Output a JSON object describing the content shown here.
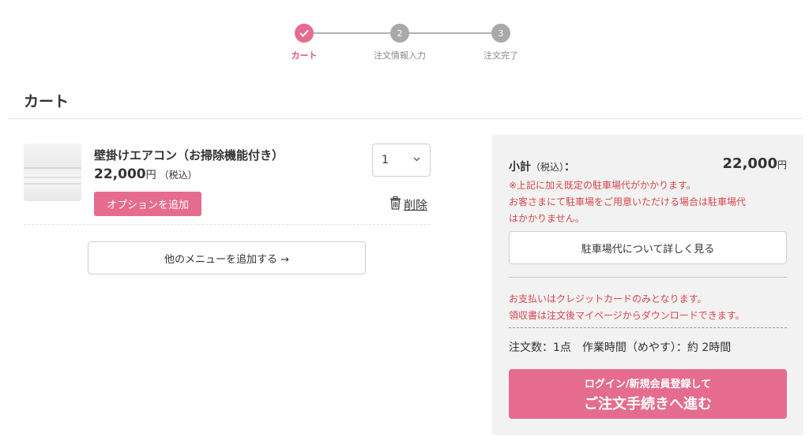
{
  "stepper": {
    "steps": [
      {
        "number": "",
        "label": "カート",
        "state": "done"
      },
      {
        "number": "2",
        "label": "注文情報入力",
        "state": "pending"
      },
      {
        "number": "3",
        "label": "注文完了",
        "state": "pending"
      }
    ]
  },
  "page": {
    "title": "カート"
  },
  "cart": {
    "item": {
      "name": "壁掛けエアコン（お掃除機能付き）",
      "price": "22,000",
      "price_unit": "円",
      "tax_note": "（税込）",
      "option_label": "オプションを追加",
      "quantity": "1",
      "delete_label": "削除"
    },
    "add_menu_label": "他のメニューを追加する →"
  },
  "summary": {
    "subtotal_label": "小計",
    "subtotal_tax": "（税込）",
    "subtotal_colon": "：",
    "subtotal_value": "22,000",
    "subtotal_unit": "円",
    "notice_lines": [
      "※上記に加え既定の駐車場代がかかります。",
      "お客さまにて駐車場をご用意いただける場合は駐車場代",
      "はかかりません。"
    ],
    "parking_button": "駐車場代について詳しく見る",
    "payment_lines": [
      "お支払いはクレジットカードのみとなります。",
      "領収書は注文後マイページからダウンロードできます。"
    ],
    "order_info": "注文数：1点　作業時間（めやす）：約 2時間",
    "checkout_line1": "ログイン/新規会員登録して",
    "checkout_line2": "ご注文手続きへ進む"
  },
  "colors": {
    "accent": "#e56c8f",
    "notice": "#d9464c",
    "panel": "#f2f2f2"
  }
}
